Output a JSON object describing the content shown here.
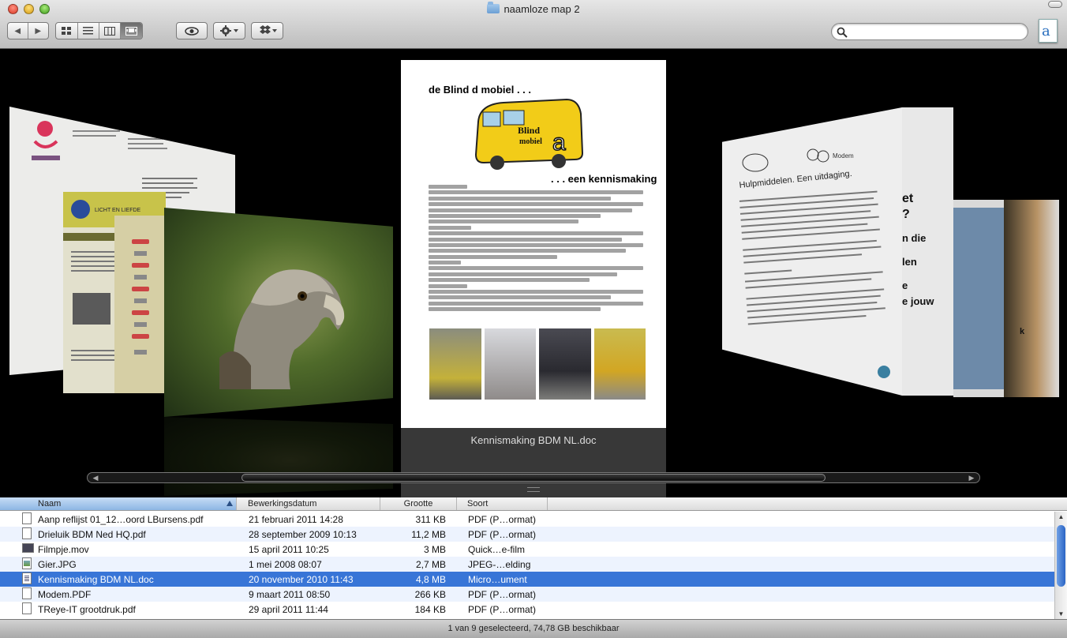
{
  "window": {
    "title": "naamloze map 2"
  },
  "toolbar": {
    "back_label": "◀",
    "forward_label": "▶",
    "view_modes": [
      "icon",
      "list",
      "column",
      "coverflow"
    ],
    "active_view": "coverflow",
    "search": {
      "value": "",
      "placeholder": ""
    }
  },
  "coverflow": {
    "caption": "Kennismaking BDM NL.doc",
    "main_doc": {
      "heading": "de Blind d mobiel . . .",
      "subheading": ". . . een kennismaking"
    }
  },
  "list": {
    "columns": [
      "Naam",
      "Bewerkingsdatum",
      "Grootte",
      "Soort"
    ],
    "sorted_column": "Naam",
    "rows": [
      {
        "name": "Aanp reflijst 01_12…oord LBursens.pdf",
        "date": "21 februari 2011 14:28",
        "size": "311 KB",
        "kind": "PDF (P…ormat)",
        "icon": "pdf-icon"
      },
      {
        "name": "Drieluik BDM Ned HQ.pdf",
        "date": "28 september 2009 10:13",
        "size": "11,2 MB",
        "kind": "PDF (P…ormat)",
        "icon": "pdf-icon"
      },
      {
        "name": "Filmpje.mov",
        "date": "15 april 2011 10:25",
        "size": "3 MB",
        "kind": "Quick…e-film",
        "icon": "movie-icon"
      },
      {
        "name": "Gier.JPG",
        "date": "1 mei 2008 08:07",
        "size": "2,7 MB",
        "kind": "JPEG-…elding",
        "icon": "image-icon"
      },
      {
        "name": "Kennismaking BDM NL.doc",
        "date": "20 november 2010 11:43",
        "size": "4,8 MB",
        "kind": "Micro…ument",
        "icon": "doc-icon",
        "selected": true
      },
      {
        "name": "Modem.PDF",
        "date": "9 maart 2011 08:50",
        "size": "266 KB",
        "kind": "PDF (P…ormat)",
        "icon": "pdf-icon"
      },
      {
        "name": "TReye-IT grootdruk.pdf",
        "date": "29 april 2011 11:44",
        "size": "184 KB",
        "kind": "PDF (P…ormat)",
        "icon": "pdf-icon"
      }
    ]
  },
  "status": {
    "text": "1 van 9 geselecteerd, 74,78 GB beschikbaar"
  },
  "colors": {
    "selection": "#3875d7",
    "alt_row": "#edf3fe",
    "bus_yellow": "#f2cc18"
  }
}
